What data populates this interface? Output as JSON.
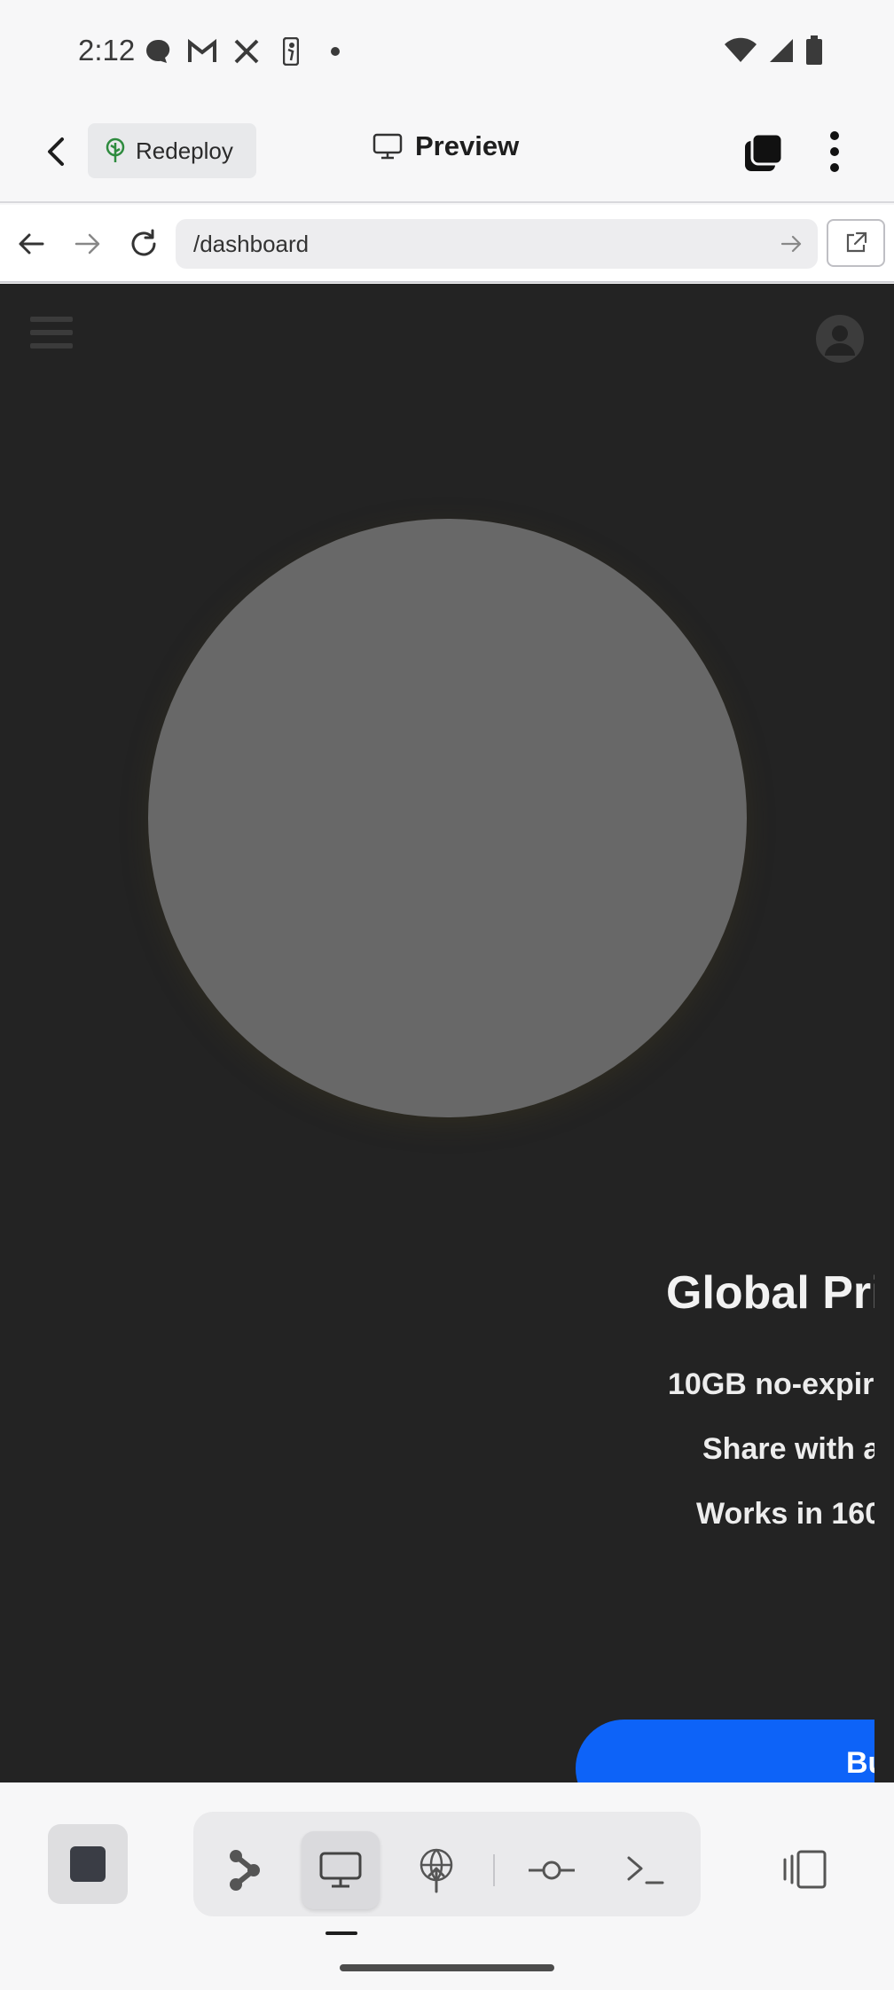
{
  "status_bar": {
    "time": "2:12",
    "left_icons": [
      "chat-bubble-icon",
      "gmail-icon",
      "x-icon",
      "nba-icon",
      "dot-icon"
    ],
    "right_icons": [
      "wifi-icon",
      "cellular-signal-icon",
      "battery-icon"
    ]
  },
  "app_bar": {
    "back_icon": "chevron-left-icon",
    "redeploy_label": "Redeploy",
    "redeploy_icon": "tree-icon",
    "title": "Preview",
    "title_icon": "monitor-icon",
    "tabs_icon": "tabs-icon",
    "more_icon": "more-vertical-icon"
  },
  "url_bar": {
    "back_icon": "arrow-left-icon",
    "forward_icon": "arrow-right-icon",
    "reload_icon": "reload-icon",
    "url": "/dashboard",
    "go_icon": "arrow-right-icon",
    "external_icon": "external-link-icon"
  },
  "page": {
    "menu_icon": "hamburger-menu-icon",
    "avatar_icon": "user-avatar-icon",
    "hero_title": "Global Pri",
    "features": [
      "10GB no-expir",
      "Share with a",
      "Works in 160"
    ],
    "cta_label": "Bu"
  },
  "colors": {
    "page_background": "#232323",
    "hero_circle": "#686868",
    "cta_background": "#0d63f8",
    "redeploy_icon": "#2e8b3e"
  },
  "toolbar": {
    "stop_icon": "stop-icon",
    "tools": [
      {
        "name": "graph-icon",
        "active": false
      },
      {
        "name": "monitor-icon",
        "active": true
      },
      {
        "name": "globe-upload-icon",
        "active": false
      },
      {
        "name": "commit-icon",
        "active": false
      },
      {
        "name": "terminal-icon",
        "active": false
      }
    ],
    "split_icon": "split-view-icon"
  }
}
